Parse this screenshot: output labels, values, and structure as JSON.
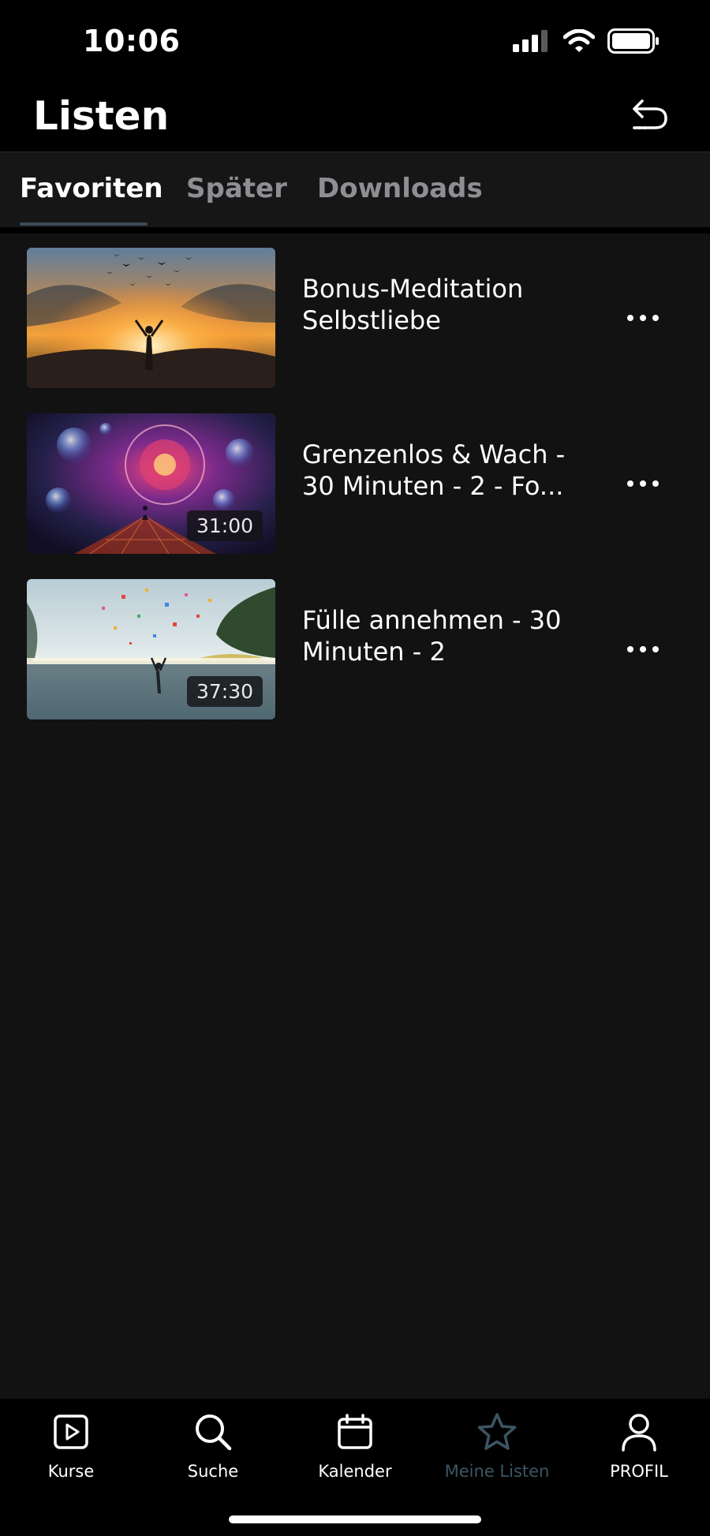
{
  "status_bar": {
    "time": "10:06"
  },
  "header": {
    "title": "Listen",
    "back_icon": "undo-arrow-icon"
  },
  "tabs": [
    {
      "label": "Favoriten",
      "active": true
    },
    {
      "label": "Später",
      "active": false
    },
    {
      "label": "Downloads",
      "active": false
    }
  ],
  "items": [
    {
      "title": "Bonus-Meditation Selbstliebe",
      "duration": ""
    },
    {
      "title": "Grenzenlos & Wach - 30 Minuten - 2 - Fo...",
      "duration": "31:00"
    },
    {
      "title": "Fülle annehmen - 30 Minuten - 2",
      "duration": "37:30"
    }
  ],
  "bottom_nav": [
    {
      "label": "Kurse",
      "icon": "play-square-icon",
      "active": false
    },
    {
      "label": "Suche",
      "icon": "search-icon",
      "active": false
    },
    {
      "label": "Kalender",
      "icon": "calendar-icon",
      "active": false
    },
    {
      "label": "Meine Listen",
      "icon": "star-icon",
      "active": true
    },
    {
      "label": "PROFIL",
      "icon": "user-icon",
      "active": false
    }
  ],
  "colors": {
    "background": "#121213",
    "bar_background": "#000000",
    "active_nav": "#3c5564",
    "inactive_tab": "#8e8e93"
  }
}
